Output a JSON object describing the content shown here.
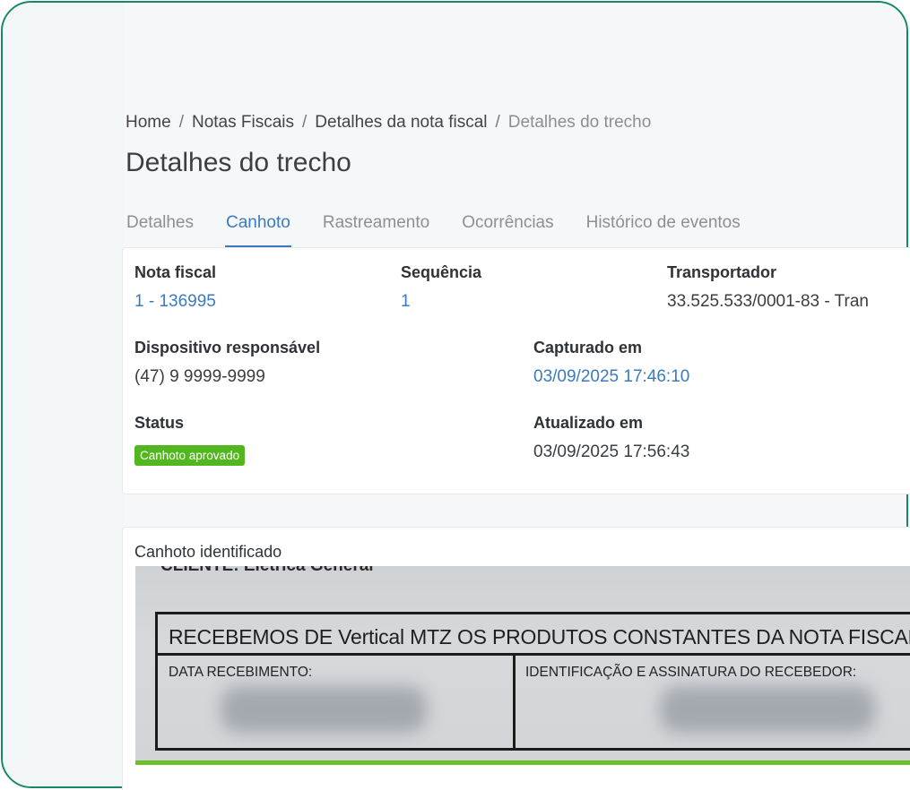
{
  "breadcrumb": {
    "home": "Home",
    "separator": "/",
    "notas": "Notas Fiscais",
    "detalhes_nota": "Detalhes da nota fiscal",
    "current": "Detalhes do trecho"
  },
  "page_title": "Detalhes do trecho",
  "tabs": [
    {
      "label": "Detalhes"
    },
    {
      "label": "Canhoto",
      "active": true
    },
    {
      "label": "Rastreamento"
    },
    {
      "label": "Ocorrências"
    },
    {
      "label": "Histórico de eventos"
    }
  ],
  "info": {
    "nota_fiscal_label": "Nota fiscal",
    "nota_fiscal_value": "1 - 136995",
    "sequencia_label": "Sequência",
    "sequencia_value": "1",
    "transportador_label": "Transportador",
    "transportador_value": "33.525.533/0001-83 - Tran",
    "dispositivo_label": "Dispositivo responsável",
    "dispositivo_value": "(47) 9 9999-9999",
    "capturado_label": "Capturado em",
    "capturado_value": "03/09/2025 17:46:10",
    "status_label": "Status",
    "status_value": "Canhoto aprovado",
    "atualizado_label": "Atualizado em",
    "atualizado_value": "03/09/2025 17:56:43"
  },
  "canhoto": {
    "title": "Canhoto identificado",
    "client_line": "CLIENTE: Eletrica General",
    "header_text": "RECEBEMOS DE Vertical MTZ OS PRODUTOS CONSTANTES DA NOTA FISCAL",
    "data_label": "DATA RECEBIMENTO:",
    "assinatura_label": "IDENTIFICAÇÃO E ASSINATURA DO RECEBEDOR:"
  },
  "colors": {
    "accent": "#3a7bbf",
    "badge_green": "#52b71f",
    "frame_border": "#17876b"
  }
}
